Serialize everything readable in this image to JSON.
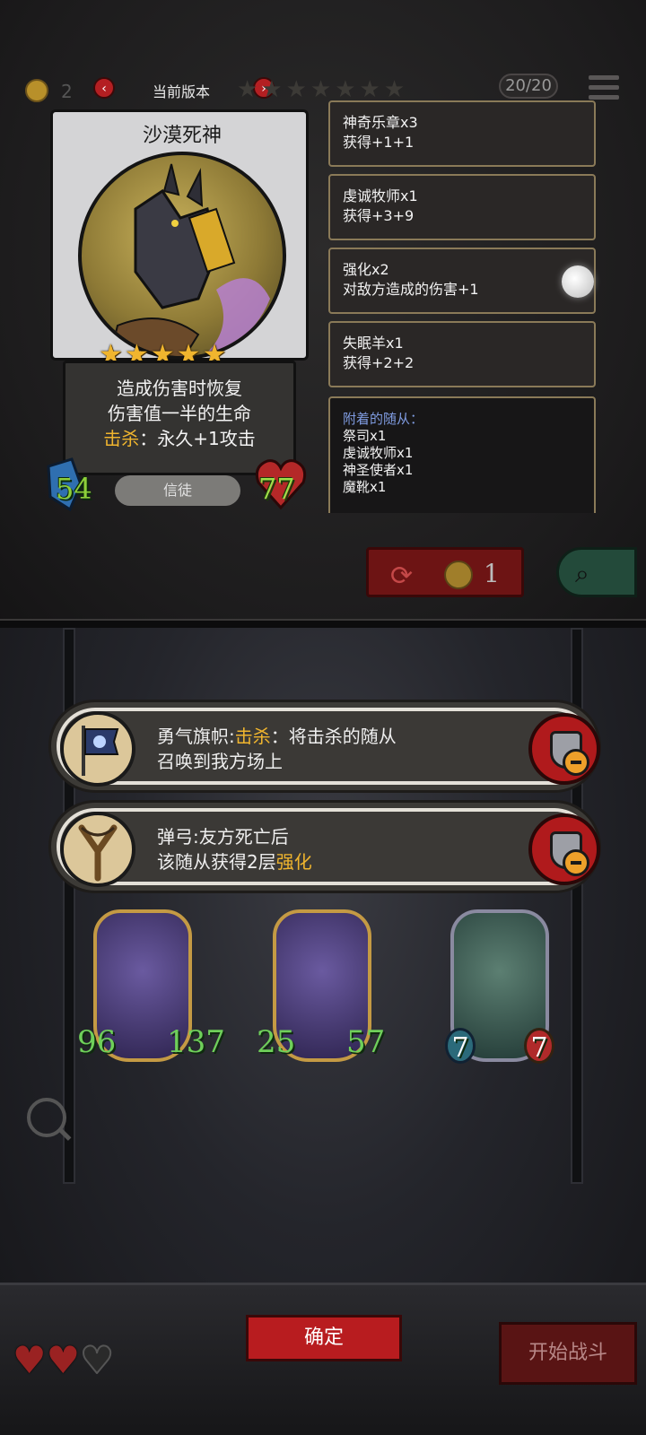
{
  "header": {
    "coins": "2",
    "version_label": "当前版本",
    "prev_label": "‹",
    "next_label": "›",
    "tier_stars": "★★★★★★★",
    "counter": "20/20"
  },
  "hero_card": {
    "name": "沙漠死神",
    "stars": "★★★★★",
    "desc_line1": "造成伤害时恢复",
    "desc_line2": "伤害值一半的生命",
    "desc_kill_label": "击杀",
    "desc_kill_text": "：永久+1攻击",
    "attack": "54",
    "health": "77",
    "tribe": "信徒"
  },
  "buffs": [
    {
      "title": "神奇乐章x3",
      "effect": "获得+1+1"
    },
    {
      "title": "虔诚牧师x1",
      "effect": "获得+3+9"
    },
    {
      "title": "强化x2",
      "effect": "对敌方造成的伤害+1"
    },
    {
      "title": "失眠羊x1",
      "effect": "获得+2+2"
    }
  ],
  "attached": {
    "title": "附着的随从：",
    "items": [
      "祭司x1",
      "虔诚牧师x1",
      "神圣使者x1",
      "魔靴x1"
    ]
  },
  "refresh": {
    "cost": "1"
  },
  "items": [
    {
      "name": "勇气旗帜:",
      "kill_label": "击杀",
      "text_after": "：将击杀的随从",
      "line2": "召唤到我方场上"
    },
    {
      "name": "弹弓:",
      "line1_text": "友方死亡后",
      "line2_prefix": "该随从获得2层",
      "line2_highlight": "强化"
    }
  ],
  "minions": [
    {
      "attack": "96",
      "health": "137"
    },
    {
      "attack": "25",
      "health": "57"
    },
    {
      "attack": "7",
      "health": "7"
    }
  ],
  "footer": {
    "confirm_label": "确定",
    "start_label": "开始战斗",
    "lives_full": "♥♥",
    "lives_empty": "♥"
  },
  "colors": {
    "accent_red": "#b81c1f",
    "highlight_gold": "#f0b52e",
    "stat_green": "#6fd05a",
    "attached_title": "#7f9be0"
  }
}
